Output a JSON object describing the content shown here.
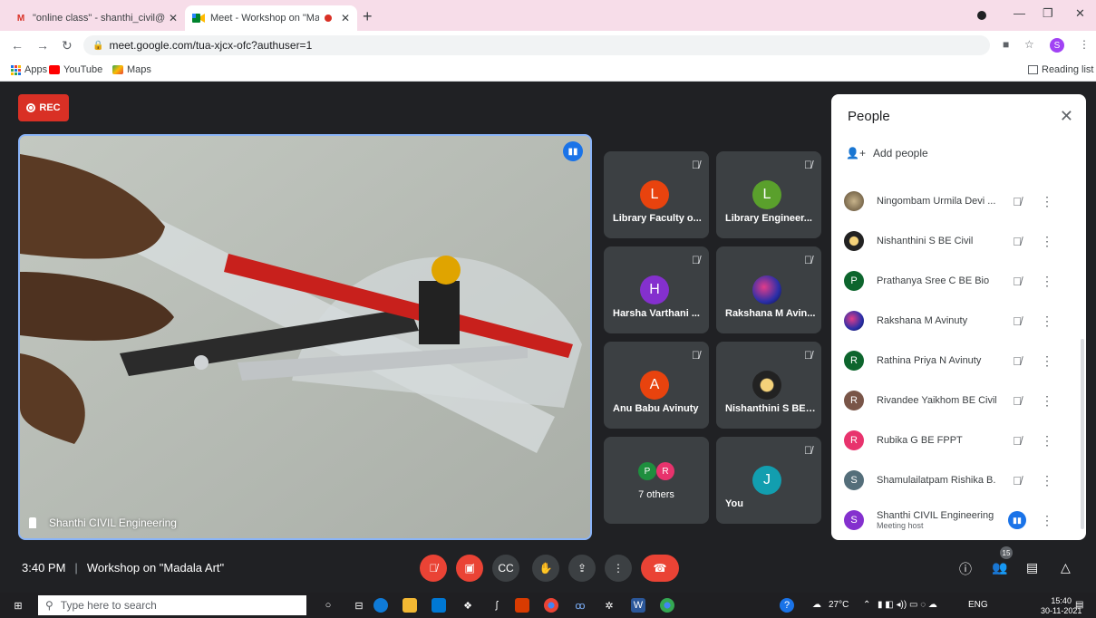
{
  "browser": {
    "tabs": [
      {
        "title": "\"online class\" - shanthi_civil@avi",
        "icon": "gmail-icon",
        "active": false
      },
      {
        "title": "Meet - Workshop on \"Madal",
        "icon": "meet-icon",
        "active": true
      }
    ],
    "url": "meet.google.com/tua-xjcx-ofc?authuser=1",
    "bookmarks": [
      "Apps",
      "YouTube",
      "Maps"
    ],
    "reading_list": "Reading list",
    "profile_initial": "S"
  },
  "meet": {
    "rec_label": "REC",
    "main_speaker": "Shanthi CIVIL Engineering",
    "tiles": [
      {
        "initial": "L",
        "name": "Library Faculty o...",
        "color": "#e8430e"
      },
      {
        "initial": "L",
        "name": "Library Engineer...",
        "color": "#5aa02c"
      },
      {
        "initial": "H",
        "name": "Harsha Varthani ...",
        "color": "#8430ce"
      },
      {
        "initial": "",
        "name": "Rakshana M Avin...",
        "color": "#3b3c9a"
      },
      {
        "initial": "A",
        "name": "Anu Babu Avinuty",
        "color": "#e8430e"
      },
      {
        "initial": "",
        "name": "Nishanthini S BE ...",
        "color": "#222222"
      },
      {
        "initial": "P",
        "initial2": "R",
        "name": "7 others",
        "color": "#1e8e3e",
        "color2": "#e8336d"
      },
      {
        "initial": "J",
        "name": "You",
        "color": "#129eaf"
      }
    ],
    "time": "3:40 PM",
    "meeting_title": "Workshop on \"Madala Art\"",
    "participants_count": "15"
  },
  "people_panel": {
    "title": "People",
    "add_people": "Add people",
    "participants": [
      {
        "name": "Ningombam Urmila Devi ...",
        "initial": "",
        "color": "#8a7a5c"
      },
      {
        "name": "Nishanthini S BE Civil",
        "initial": "",
        "color": "#222222"
      },
      {
        "name": "Prathanya Sree C BE Bio",
        "initial": "P",
        "color": "#0d652d"
      },
      {
        "name": "Rakshana M Avinuty",
        "initial": "",
        "color": "#3b3c9a"
      },
      {
        "name": "Rathina Priya N Avinuty",
        "initial": "R",
        "color": "#0d652d"
      },
      {
        "name": "Rivandee Yaikhom BE Civil",
        "initial": "R",
        "color": "#795548"
      },
      {
        "name": "Rubika G BE FPPT",
        "initial": "R",
        "color": "#e8336d"
      },
      {
        "name": "Shamulailatpam Rishika B...",
        "initial": "S",
        "color": "#546e7a"
      },
      {
        "name": "Shanthi CIVIL Engineering",
        "sub": "Meeting host",
        "initial": "S",
        "color": "#8430ce"
      }
    ]
  },
  "taskbar": {
    "search_placeholder": "Type here to search",
    "weather": "27°C",
    "lang": "ENG",
    "time": "15:40",
    "date": "30-11-2021"
  }
}
